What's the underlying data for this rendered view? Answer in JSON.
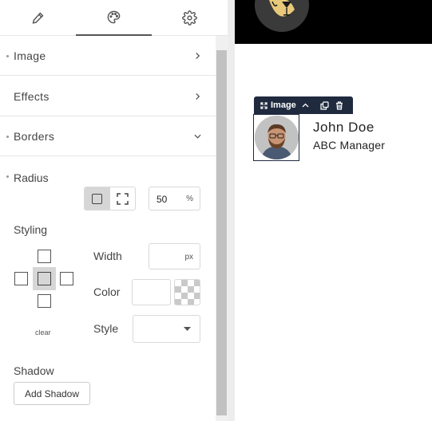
{
  "tabs": [
    {
      "name": "content",
      "icon": "pencil-icon"
    },
    {
      "name": "style",
      "icon": "palette-icon"
    },
    {
      "name": "advanced",
      "icon": "gear-icon"
    }
  ],
  "sections": {
    "image": "Image",
    "effects": "Effects",
    "borders": "Borders"
  },
  "borders": {
    "radius_label": "Radius",
    "radius_value": "50",
    "radius_unit": "%",
    "styling_label": "Styling",
    "clear_label": "clear",
    "width_label": "Width",
    "width_value": "",
    "width_unit": "px",
    "color_label": "Color",
    "style_label": "Style",
    "style_value": "",
    "shadow_label": "Shadow",
    "add_shadow": "Add Shadow"
  },
  "canvas": {
    "toolbar_label": "Image",
    "person_name": "John Doe",
    "person_title": "ABC Manager"
  },
  "colors": {
    "toolbar_bg": "#1f2a3f",
    "accent": "#555555",
    "logo_gold": "#e8c97a"
  }
}
